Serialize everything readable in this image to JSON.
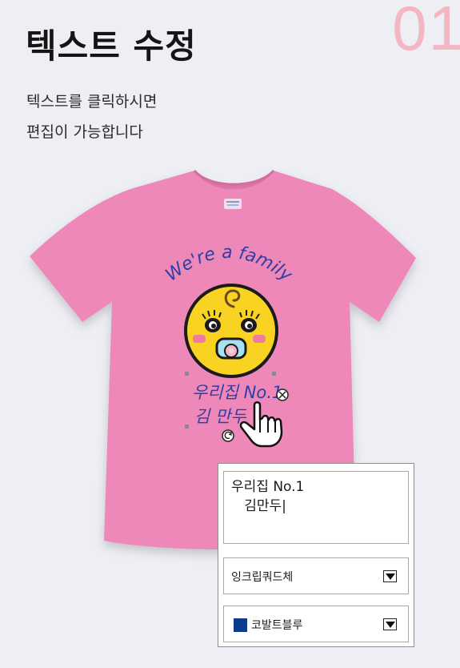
{
  "step_number": "01",
  "title": "텍스트 수정",
  "description": [
    "텍스트를 클릭하시면",
    "편집이 가능합니다"
  ],
  "shirt": {
    "color": "#ee88b8",
    "print_top_text": "We're a family",
    "print_line1": "우리집 No.1",
    "print_line2": "김 만두"
  },
  "editor": {
    "text_value": "우리집 No.1\n   김만두|",
    "font_select": "잉크립쿼드체",
    "color_select": "코발트블루",
    "color_swatch": "#0a3c8c"
  },
  "icons": [
    "delete-icon",
    "rotate-icon",
    "hand-cursor-icon",
    "dropdown-caret-icon"
  ]
}
